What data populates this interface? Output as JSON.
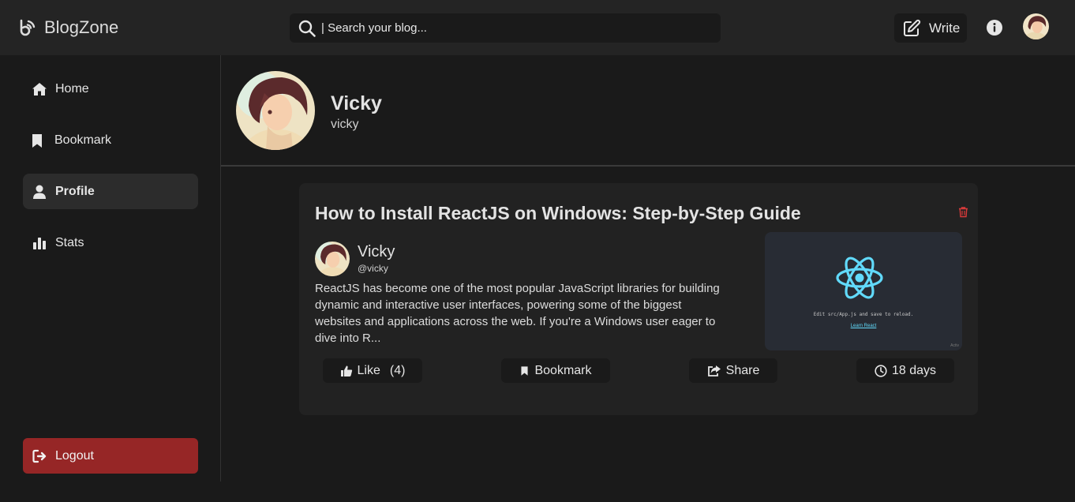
{
  "app": {
    "name": "BlogZone"
  },
  "header": {
    "search_placeholder": "| Search your blog...",
    "write_label": "Write"
  },
  "sidebar": {
    "items": [
      {
        "label": "Home",
        "icon": "home-icon"
      },
      {
        "label": "Bookmark",
        "icon": "bookmark-icon"
      },
      {
        "label": "Profile",
        "icon": "user-icon",
        "active": true
      },
      {
        "label": "Stats",
        "icon": "bar-chart-icon"
      }
    ],
    "logout_label": "Logout"
  },
  "profile": {
    "name": "Vicky",
    "username": "vicky"
  },
  "post": {
    "title": "How to Install ReactJS on Windows: Step-by-Step Guide",
    "author_name": "Vicky",
    "author_handle": "@vicky",
    "excerpt": "ReactJS has become one of the most popular JavaScript libraries for building dynamic and interactive user interfaces, powering some of the biggest websites and applications across the web. If you're a Windows user eager to dive into R...",
    "thumbnail": {
      "caption": "Edit src/App.js and save to reload.",
      "link": "Learn React",
      "corner": "Activ"
    },
    "actions": {
      "like_label": "Like",
      "like_count": "(4)",
      "bookmark_label": "Bookmark",
      "share_label": "Share",
      "age": "18 days"
    }
  },
  "colors": {
    "background": "#1a1a1a",
    "header": "#242424",
    "card": "#222222",
    "logout": "#962626",
    "delete": "#d73a3a",
    "react": "#61dafb"
  }
}
